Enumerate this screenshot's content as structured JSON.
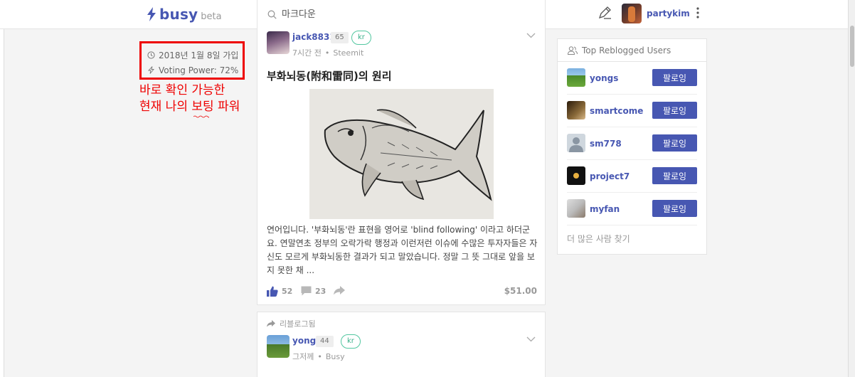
{
  "app": {
    "logo_name": "busy",
    "logo_badge": "beta"
  },
  "search": {
    "placeholder": "마크다운"
  },
  "user": {
    "username": "partykim"
  },
  "profile_info": {
    "join_date": "2018년 1월 8일 가입",
    "voting_power": "Voting Power: 72%"
  },
  "annotation": {
    "line1": "바로 확인 가능한",
    "line2": "현재 나의 보팅 파워"
  },
  "posts": [
    {
      "author": "jack8831",
      "reputation": "65",
      "tag": "kr",
      "time": "7시간 전",
      "app": "Steemit",
      "title": "부화뇌동(附和雷同)의 원리",
      "excerpt": "연어입니다. '부화뇌동'란 표현을 영어로 'blind following' 이라고 하더군요. 연말연초 정부의 오락가락 행정과 이런저런 이슈에 수많은 투자자들은 자신도 모르게 부화뇌동한 결과가 되고 말았습니다. 정말 그 뜻 그대로 앞을 보지 못한 채 ...",
      "likes": "52",
      "comments": "23",
      "payout": "$51.00"
    },
    {
      "reblog_label": "리블로그됨",
      "author": "yongs",
      "reputation": "44",
      "tag": "kr",
      "time": "그저께",
      "app": "Busy"
    }
  ],
  "sidebar": {
    "title": "Top Reblogged Users",
    "follow_label": "팔로잉",
    "users": [
      {
        "name": "yongs"
      },
      {
        "name": "smartcome"
      },
      {
        "name": "sm778"
      },
      {
        "name": "project7"
      },
      {
        "name": "myfan"
      }
    ],
    "more_label": "더 많은 사람 찾기"
  },
  "colors": {
    "brand": "#4757b2",
    "annotation": "#e00000",
    "tag": "#52c7a0"
  }
}
